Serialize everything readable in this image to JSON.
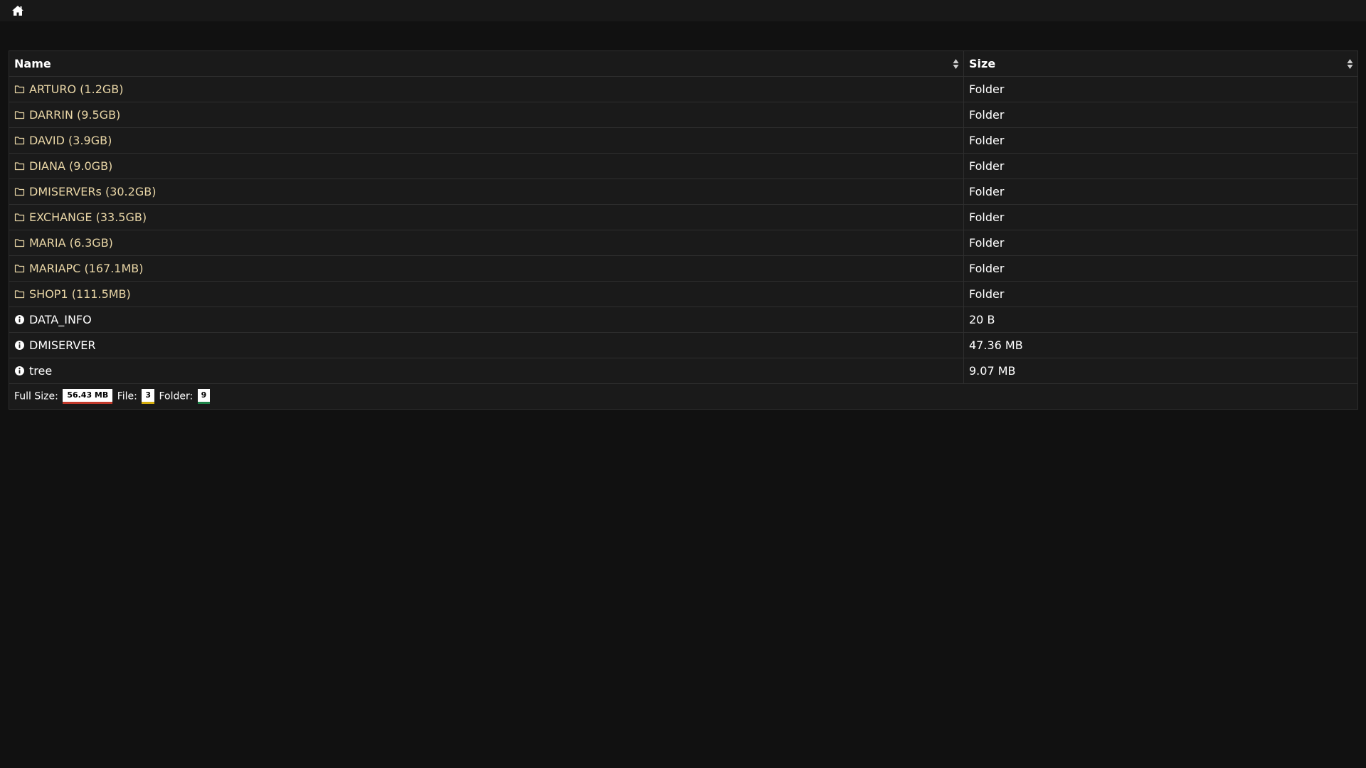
{
  "header": {
    "home_icon": "home-icon"
  },
  "table": {
    "columns": [
      {
        "label": "Name"
      },
      {
        "label": "Size"
      }
    ],
    "rows": [
      {
        "type": "folder",
        "name": "ARTURO (1.2GB)",
        "size": "Folder"
      },
      {
        "type": "folder",
        "name": "DARRIN (9.5GB)",
        "size": "Folder"
      },
      {
        "type": "folder",
        "name": "DAVID (3.9GB)",
        "size": "Folder"
      },
      {
        "type": "folder",
        "name": "DIANA (9.0GB)",
        "size": "Folder"
      },
      {
        "type": "folder",
        "name": "DMISERVERs (30.2GB)",
        "size": "Folder"
      },
      {
        "type": "folder",
        "name": "EXCHANGE (33.5GB)",
        "size": "Folder"
      },
      {
        "type": "folder",
        "name": "MARIA (6.3GB)",
        "size": "Folder"
      },
      {
        "type": "folder",
        "name": "MARIAPC (167.1MB)",
        "size": "Folder"
      },
      {
        "type": "folder",
        "name": "SHOP1 (111.5MB)",
        "size": "Folder"
      },
      {
        "type": "file",
        "name": "DATA_INFO",
        "size": "20 B"
      },
      {
        "type": "file",
        "name": "DMISERVER",
        "size": "47.36 MB"
      },
      {
        "type": "file",
        "name": "tree",
        "size": "9.07 MB"
      }
    ]
  },
  "footer": {
    "full_size_label": "Full Size:",
    "full_size_value": "56.43 MB",
    "file_label": "File:",
    "file_count": "3",
    "folder_label": "Folder:",
    "folder_count": "9"
  },
  "colors": {
    "background": "#111111",
    "folder_text": "#e9d6a6",
    "full_size_underline": "#c0392b",
    "file_underline": "#d4ac0d",
    "folder_underline": "#1e8449"
  }
}
